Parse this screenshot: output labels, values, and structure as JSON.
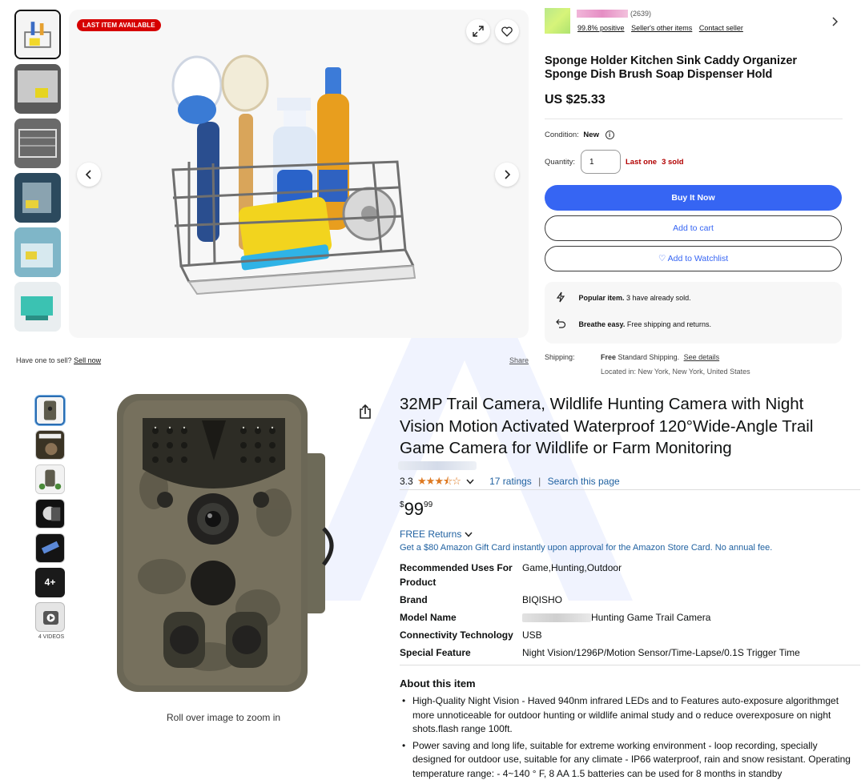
{
  "ebay": {
    "badge": "LAST ITEM AVAILABLE",
    "seller": {
      "feedback_count": "(2639)",
      "positive": "99.8% positive",
      "other_items": "Seller's other items",
      "contact": "Contact seller"
    },
    "title": "Sponge Holder Kitchen Sink Caddy Organizer Sponge Dish Brush Soap Dispenser Hold",
    "price": "US $25.33",
    "condition_label": "Condition:",
    "condition_value": "New",
    "quantity_label": "Quantity:",
    "quantity_value": "1",
    "last_one": "Last one",
    "sold": "3 sold",
    "buy_now": "Buy It Now",
    "add_to_cart": "Add to cart",
    "add_to_watchlist": "Add to Watchlist",
    "popular_bold": "Popular item.",
    "popular_text": "3 have already sold.",
    "breathe_bold": "Breathe easy.",
    "breathe_text": "Free shipping and returns.",
    "have_one": "Have one to sell?",
    "sell_now": "Sell now",
    "share": "Share",
    "shipping_label": "Shipping:",
    "shipping_free": "Free",
    "shipping_text": "Standard Shipping.",
    "see_details": "See details",
    "located": "Located in: New York, New York, United States",
    "icons": {
      "expand": "expand-icon",
      "heart": "heart-icon",
      "prev": "chevron-left-icon",
      "next": "chevron-right-icon",
      "info": "info-icon",
      "bolt": "lightning-icon",
      "return": "return-arrow-icon"
    }
  },
  "amazon": {
    "title": "32MP Trail Camera, Wildlife Hunting Camera with Night Vision Motion Activated Waterproof 120°Wide-Angle Trail Game Camera for Wildlife or Farm Monitoring",
    "rating": "3.3",
    "rating_value": 3.3,
    "ratings_count": "17 ratings",
    "search_page": "Search this page",
    "price_symbol": "$",
    "price_whole": "99",
    "price_fraction": "99",
    "free_returns": "FREE Returns",
    "gift_card": "Get a $80 Amazon Gift Card instantly upon approval for the Amazon Store Card. No annual fee.",
    "specs": [
      {
        "key": "Recommended Uses For Product",
        "value": "Game,Hunting,Outdoor"
      },
      {
        "key": "Brand",
        "value": "BIQISHO"
      },
      {
        "key": "Model Name",
        "value": "Hunting Game Trail Camera"
      },
      {
        "key": "Connectivity Technology",
        "value": "USB"
      },
      {
        "key": "Special Feature",
        "value": "Night Vision/1296P/Motion Sensor/Time-Lapse/0.1S Trigger Time"
      }
    ],
    "about_heading": "About this item",
    "bullets": [
      "High-Quality Night Vision - Haved 940nm infrared LEDs and to Features auto-exposure algorithmget more unnoticeable for outdoor hunting or wildlife animal study and o reduce overexposure on night shots.flash range 100ft.",
      "Power saving and long life, suitable for extreme working environment - loop recording, specially designed for outdoor use, suitable for any climate - IP66 waterproof, rain and snow resistant. Operating temperature range: - 4~140 ° F, 8 AA 1.5 batteries can be used for 8 months in standby"
    ],
    "more_images": "4+",
    "videos_label": "4 VIDEOS",
    "zoom_hint": "Roll over image to zoom in",
    "colors": {
      "link": "#2162a1",
      "star": "#de7921"
    }
  }
}
